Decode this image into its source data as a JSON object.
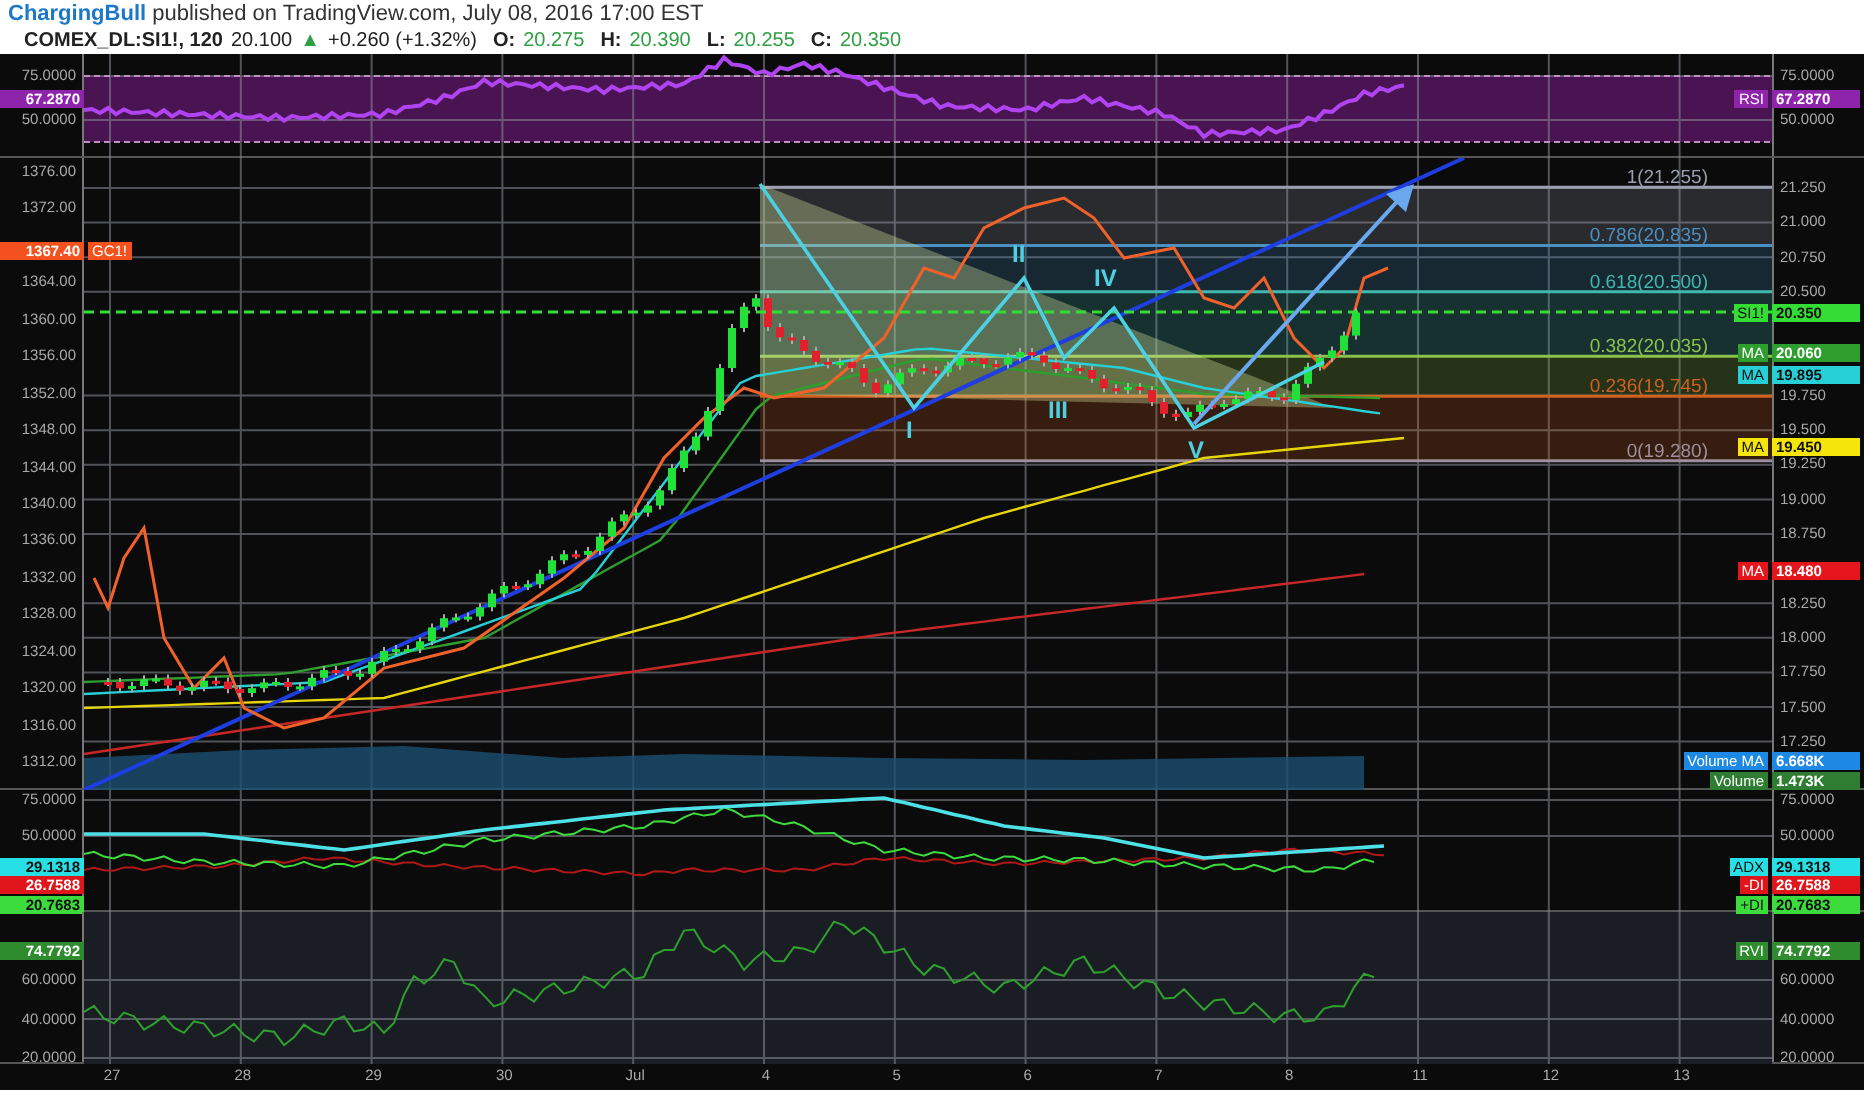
{
  "header": {
    "author": "ChargingBull",
    "published": "published on TradingView.com, July 08, 2016 17:00 EST"
  },
  "quote": {
    "symbol": "COMEX_DL:SI1!, 120",
    "last": "20.100",
    "arrow": "▲",
    "change": "+0.260 (+1.32%)",
    "ohlc": [
      {
        "label": "O:",
        "value": "20.275"
      },
      {
        "label": "H:",
        "value": "20.390"
      },
      {
        "label": "L:",
        "value": "20.255"
      },
      {
        "label": "C:",
        "value": "20.350"
      }
    ]
  },
  "panes": [
    {
      "kind": "rsi",
      "left_ticks": [
        "75.0000",
        "50.0000"
      ],
      "right_ticks": [
        "75.0000",
        "50.0000"
      ],
      "left_badges": [
        {
          "value": "67.2870",
          "color": "#8e24aa"
        }
      ],
      "right_badges": [
        {
          "label": "RSI",
          "value": "67.2870",
          "color": "#8e24aa"
        }
      ]
    },
    {
      "kind": "price",
      "left_ticks": [
        "1376.00",
        "1372.00",
        "1364.00",
        "1360.00",
        "1356.00",
        "1352.00",
        "1348.00",
        "1344.00",
        "1340.00",
        "1336.00",
        "1332.00",
        "1328.00",
        "1324.00",
        "1320.00",
        "1316.00",
        "1312.00"
      ],
      "right_ticks": [
        "21.250",
        "21.000",
        "20.750",
        "20.500",
        "19.750",
        "19.500",
        "19.250",
        "19.000",
        "18.750",
        "18.250",
        "18.000",
        "17.750",
        "17.500",
        "17.250"
      ],
      "left_badges": [
        {
          "label": "GC1!",
          "value": "1367.40",
          "color": "#f4511e"
        }
      ],
      "right_badges": [
        {
          "label": "SI1!",
          "value": "20.350",
          "color": "#33dd33"
        },
        {
          "label": "MA",
          "value": "20.060",
          "color": "#2e9e2e"
        },
        {
          "label": "MA",
          "value": "19.895",
          "color": "#26d0d6"
        },
        {
          "label": "MA",
          "value": "19.450",
          "color": "#f5e50a"
        },
        {
          "label": "MA",
          "value": "18.480",
          "color": "#e5161b"
        }
      ],
      "volume_badges": [
        {
          "label": "Volume MA",
          "value": "6.668K",
          "color": "#1e88e5"
        },
        {
          "label": "Volume",
          "value": "1.473K",
          "color": "#2e7d32"
        }
      ],
      "fib_levels": [
        {
          "label": "1(21.255)",
          "color": "#9aa0b0"
        },
        {
          "label": "0.786(20.835)",
          "color": "#4a90c2"
        },
        {
          "label": "0.618(20.500)",
          "color": "#3fb9b0"
        },
        {
          "label": "0.382(20.035)",
          "color": "#8bc34a"
        },
        {
          "label": "0.236(19.745)",
          "color": "#d2601e"
        },
        {
          "label": "0(19.280)",
          "color": "#9e8e9e"
        }
      ],
      "wave_labels": [
        "I",
        "II",
        "III",
        "IV",
        "V"
      ]
    },
    {
      "kind": "adx",
      "left_ticks": [
        "75.0000",
        "50.0000"
      ],
      "right_ticks": [
        "75.0000",
        "50.0000"
      ],
      "left_badges": [
        {
          "value": "29.1318",
          "color": "#26e0e6"
        },
        {
          "value": "26.7588",
          "color": "#e0161b"
        },
        {
          "value": "20.7683",
          "color": "#3ddc3d"
        }
      ],
      "right_badges": [
        {
          "label": "ADX",
          "value": "29.1318",
          "color": "#26e0e6"
        },
        {
          "label": "-DI",
          "value": "26.7588",
          "color": "#e0161b"
        },
        {
          "label": "+DI",
          "value": "20.7683",
          "color": "#3ddc3d"
        }
      ]
    },
    {
      "kind": "rvi",
      "left_ticks": [
        "60.0000",
        "40.0000",
        "20.0000"
      ],
      "right_ticks": [
        "60.0000",
        "40.0000",
        "20.0000"
      ],
      "left_badges": [
        {
          "value": "74.7792",
          "color": "#2e8b2e"
        }
      ],
      "right_badges": [
        {
          "label": "RVI",
          "value": "74.7792",
          "color": "#2e8b2e"
        }
      ]
    }
  ],
  "dates": [
    "27",
    "28",
    "29",
    "30",
    "Jul",
    "4",
    "5",
    "6",
    "7",
    "8",
    "11",
    "12",
    "13"
  ]
}
